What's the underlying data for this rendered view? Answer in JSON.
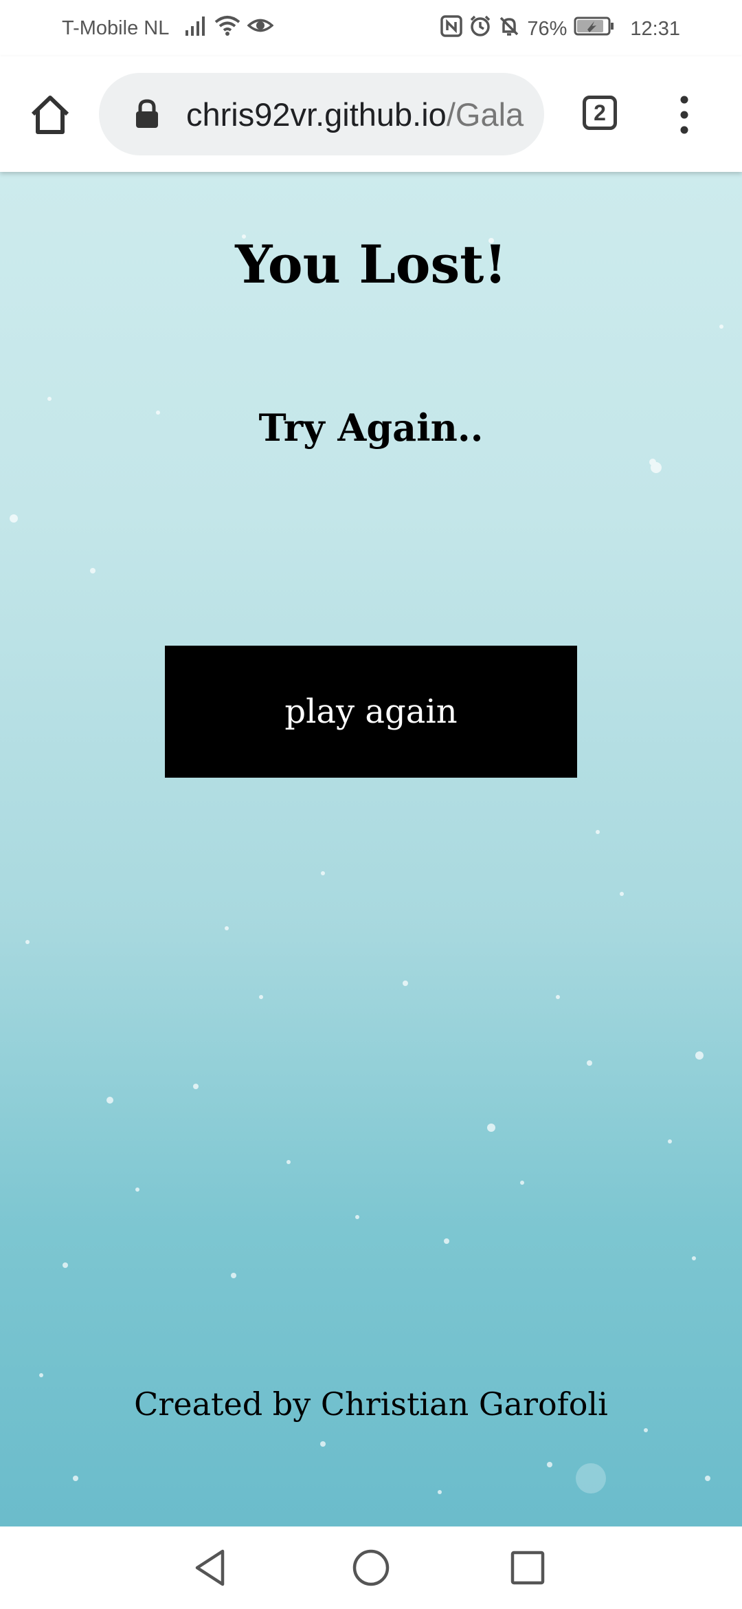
{
  "status_bar": {
    "carrier": "T-Mobile NL",
    "battery_percent": "76%",
    "time": "12:31"
  },
  "browser": {
    "url_host": "chris92vr.github.io",
    "url_path": "/Gala",
    "tab_count": "2"
  },
  "page": {
    "title": "You Lost!",
    "subtitle": "Try Again..",
    "play_again_label": "play again",
    "credit": "Created by Christian Garofoli"
  },
  "colors": {
    "background_top": "#cdebed",
    "background_bottom": "#6bbccb",
    "button_bg": "#000000",
    "button_text": "#ffffff"
  },
  "icons": {
    "status_left": [
      "signal-icon",
      "wifi-icon",
      "eye-icon"
    ],
    "status_right": [
      "nfc-icon",
      "alarm-icon",
      "mute-icon",
      "battery-icon"
    ],
    "toolbar": [
      "home-icon",
      "lock-icon",
      "menu-icon"
    ],
    "navigation": [
      "back-icon",
      "home-circle-icon",
      "recents-icon"
    ]
  }
}
